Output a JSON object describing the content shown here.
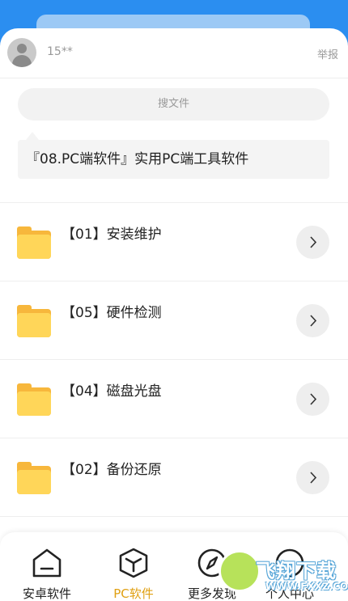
{
  "user": {
    "name": "15**",
    "report_label": "举报"
  },
  "search": {
    "placeholder": "搜文件"
  },
  "description": "『08.PC端软件』实用PC端工具软件",
  "folders": [
    {
      "label": "【01】安装维护"
    },
    {
      "label": "【05】硬件检测"
    },
    {
      "label": "【04】磁盘光盘"
    },
    {
      "label": "【02】备份还原"
    }
  ],
  "tabbar": {
    "items": [
      {
        "label": "安卓软件",
        "icon": "home-icon"
      },
      {
        "label": "PC软件",
        "icon": "cube-icon",
        "active": true
      },
      {
        "label": "更多发现",
        "icon": "compass-icon"
      },
      {
        "label": "个人中心",
        "icon": "user-icon"
      }
    ]
  },
  "watermark": {
    "title": "飞翔下载",
    "url": "WWW.FXXZ.COM"
  },
  "colors": {
    "accent": "#e0a012",
    "header": "#2b8ef0",
    "folder": "#ffd659"
  }
}
